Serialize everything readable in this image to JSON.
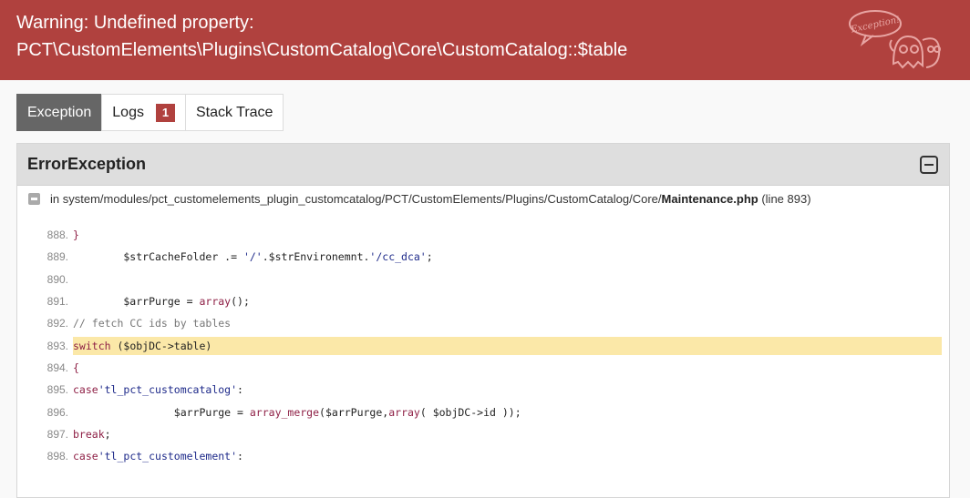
{
  "header": {
    "title_line1": "Warning: Undefined property:",
    "title_line2": "PCT\\CustomElements\\Plugins\\CustomCatalog\\Core\\CustomCatalog::$table",
    "mascot_text": "Exception!",
    "bg_color": "#b0413e"
  },
  "tabs": [
    {
      "label": "Exception",
      "active": true
    },
    {
      "label": "Logs",
      "badge": "1"
    },
    {
      "label": "Stack Trace"
    }
  ],
  "panel": {
    "title": "ErrorException",
    "file_prefix": "in system/modules/pct_customelements_plugin_customcatalog/PCT/CustomElements/Plugins/CustomCatalog/Core/",
    "file_name": "Maintenance.php",
    "file_suffix": "(line 893)"
  },
  "code": [
    {
      "num": "888.",
      "text": "        }"
    },
    {
      "num": "889.",
      "text": "        $strCacheFolder .= '/'.$strEnvironemnt.'/cc_dca';"
    },
    {
      "num": "890.",
      "text": ""
    },
    {
      "num": "891.",
      "text": "        $arrPurge = array();"
    },
    {
      "num": "892.",
      "text": "        // fetch CC ids by tables"
    },
    {
      "num": "893.",
      "text": "        switch ($objDC->table)",
      "highlight": true
    },
    {
      "num": "894.",
      "text": "        {"
    },
    {
      "num": "895.",
      "text": "            case 'tl_pct_customcatalog':"
    },
    {
      "num": "896.",
      "text": "                $arrPurge = array_merge($arrPurge,array( $objDC->id ));"
    },
    {
      "num": "897.",
      "text": "                break;"
    },
    {
      "num": "898.",
      "text": "            case 'tl_pct_customelement':"
    }
  ]
}
